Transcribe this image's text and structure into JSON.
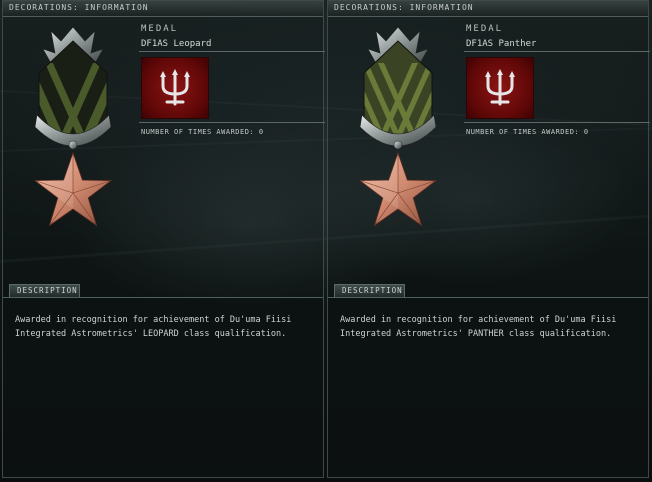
{
  "panels": [
    {
      "window_title": "DECORATIONS: INFORMATION",
      "section_label": "MEDAL",
      "medal_name": "DF1AS Leopard",
      "times_awarded_label": "NUMBER OF TIMES AWARDED: 0",
      "description_tab": "DESCRIPTION",
      "description_text": "Awarded in recognition for achievement of Du'uma Fiisi Integrated Astrometrics' LEOPARD class qualification.",
      "ribbon_stripe_colors": [
        "#1a1f16",
        "#4b5a2a",
        "#1a1f16",
        "#4b5a2a",
        "#1a1f16"
      ],
      "emblem_icon": "trident-icon",
      "medal_icon": "star-icon"
    },
    {
      "window_title": "DECORATIONS: INFORMATION",
      "section_label": "MEDAL",
      "medal_name": "DF1AS Panther",
      "times_awarded_label": "NUMBER OF TIMES AWARDED: 0",
      "description_tab": "DESCRIPTION",
      "description_text": "Awarded in recognition for achievement of Du'uma Fiisi Integrated Astrometrics' PANTHER class qualification.",
      "ribbon_stripe_colors": [
        "#3a4424",
        "#5a6a30",
        "#3a4424",
        "#5a6a30",
        "#3a4424"
      ],
      "emblem_icon": "trident-icon",
      "medal_icon": "star-icon"
    }
  ],
  "colors": {
    "emblem_red": "#8c1414",
    "star_copper": "#d98e74",
    "panel_border": "#3d4a48"
  }
}
